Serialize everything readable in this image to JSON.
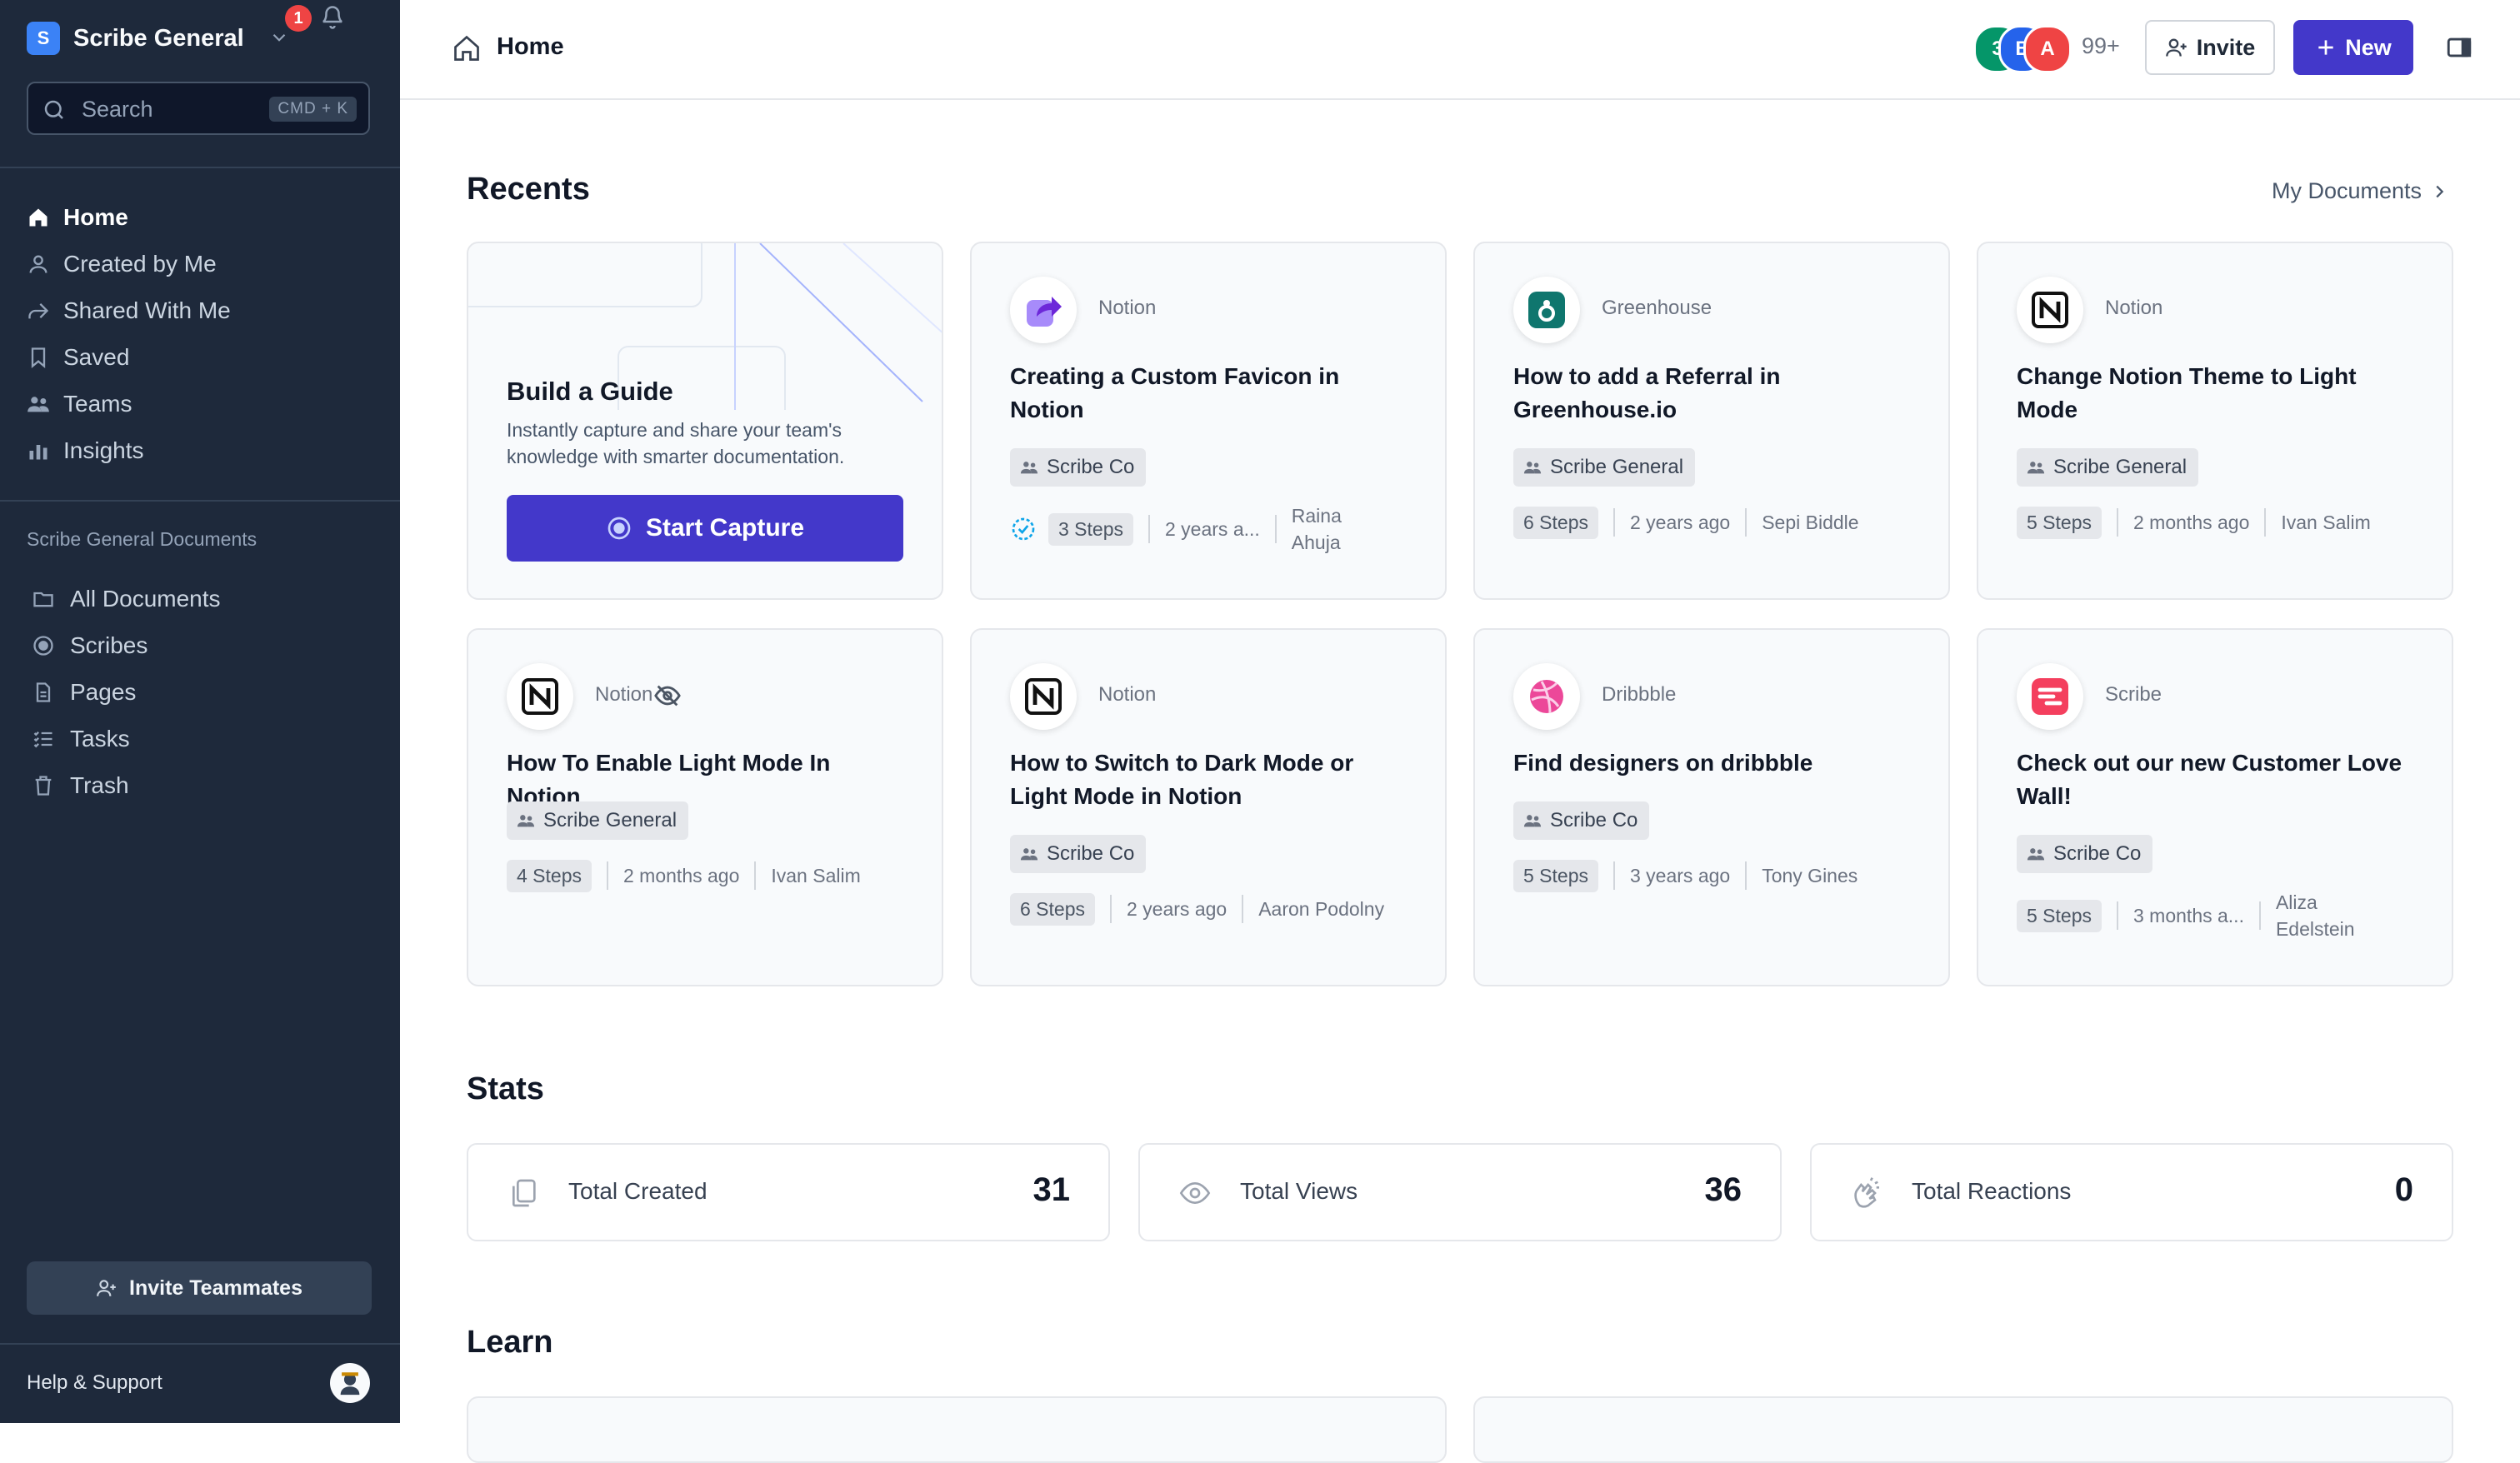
{
  "sidebar": {
    "workspace": {
      "initial": "S",
      "name": "Scribe General"
    },
    "notifications": "1",
    "search": {
      "placeholder": "Search",
      "shortcut": "CMD + K"
    },
    "nav": [
      {
        "label": "Home",
        "icon": "home-icon",
        "active": true
      },
      {
        "label": "Created by Me",
        "icon": "user-icon"
      },
      {
        "label": "Shared With Me",
        "icon": "share-icon"
      },
      {
        "label": "Saved",
        "icon": "bookmark-icon"
      },
      {
        "label": "Teams",
        "icon": "users-icon"
      },
      {
        "label": "Insights",
        "icon": "chart-icon"
      }
    ],
    "documents_title": "Scribe General Documents",
    "documents": [
      {
        "label": "All Documents",
        "icon": "folder-icon"
      },
      {
        "label": "Scribes",
        "icon": "record-icon"
      },
      {
        "label": "Pages",
        "icon": "page-icon"
      },
      {
        "label": "Tasks",
        "icon": "tasks-icon"
      },
      {
        "label": "Trash",
        "icon": "trash-icon"
      }
    ],
    "invite_label": "Invite Teammates",
    "help_label": "Help & Support"
  },
  "topbar": {
    "breadcrumb": "Home",
    "avatars": [
      {
        "initial": "3",
        "color": "#059669"
      },
      {
        "initial": "B",
        "color": "#2563eb"
      },
      {
        "initial": "A",
        "color": "#ef4444"
      }
    ],
    "more_count": "99+",
    "invite_label": "Invite",
    "new_label": "New"
  },
  "recents": {
    "title": "Recents",
    "my_documents": "My Documents",
    "guide": {
      "title": "Build a Guide",
      "description": "Instantly capture and share your team's knowledge with smarter documentation.",
      "button": "Start Capture"
    },
    "cards": [
      {
        "source": "Notion",
        "logo": "favicon-share-icon",
        "title": "Creating a Custom Favicon in Notion",
        "team": "Scribe Co",
        "verified": true,
        "steps": "3 Steps",
        "time": "2 years a...",
        "author": "Raina Ahuja"
      },
      {
        "source": "Greenhouse",
        "logo": "greenhouse-icon",
        "title": "How to add a Referral in Greenhouse.io",
        "team": "Scribe General",
        "steps": "6 Steps",
        "time": "2 years ago",
        "author": "Sepi Biddle"
      },
      {
        "source": "Notion",
        "logo": "notion-icon",
        "title": "Change Notion Theme to Light Mode",
        "team": "Scribe General",
        "steps": "5 Steps",
        "time": "2 months ago",
        "author": "Ivan Salim"
      },
      {
        "source": "Notion",
        "logo": "notion-icon",
        "hidden": true,
        "title": "How To Enable Light Mode In Notion",
        "team": "Scribe General",
        "steps": "4 Steps",
        "time": "2 months ago",
        "author": "Ivan Salim"
      },
      {
        "source": "Notion",
        "logo": "notion-icon",
        "title": "How to Switch to Dark Mode or Light Mode in Notion",
        "team": "Scribe Co",
        "steps": "6 Steps",
        "time": "2 years ago",
        "author": "Aaron Podolny"
      },
      {
        "source": "Dribbble",
        "logo": "dribbble-icon",
        "title": "Find designers on dribbble",
        "team": "Scribe Co",
        "steps": "5 Steps",
        "time": "3 years ago",
        "author": "Tony Gines"
      },
      {
        "source": "Scribe",
        "logo": "scribe-icon",
        "title": "Check out our new Customer Love Wall!",
        "team": "Scribe Co",
        "steps": "5 Steps",
        "time": "3 months a...",
        "author": "Aliza Edelstein"
      }
    ]
  },
  "stats": {
    "title": "Stats",
    "items": [
      {
        "label": "Total Created",
        "value": "31",
        "icon": "copy-icon"
      },
      {
        "label": "Total Views",
        "value": "36",
        "icon": "eye-icon"
      },
      {
        "label": "Total Reactions",
        "value": "0",
        "icon": "clap-icon"
      }
    ]
  },
  "learn": {
    "title": "Learn"
  },
  "colors": {
    "sidebar_bg": "#1e293b",
    "accent": "#4338ca",
    "card_bg": "#f8fafc"
  }
}
